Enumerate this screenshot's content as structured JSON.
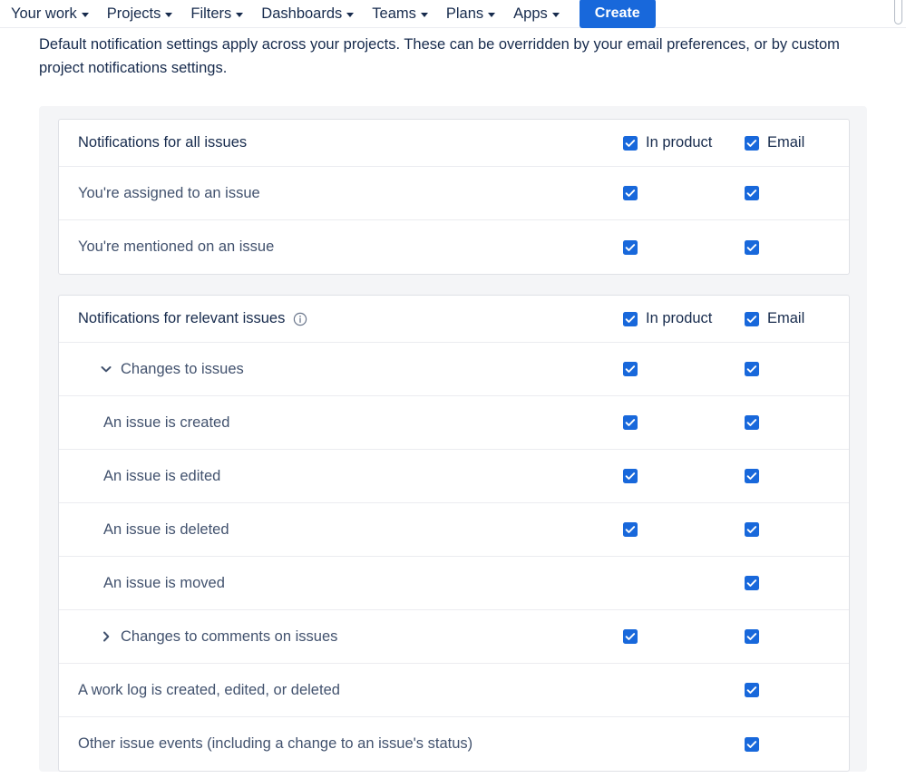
{
  "nav": {
    "items": [
      {
        "label": "Your work",
        "has_caret": true
      },
      {
        "label": "Projects",
        "has_caret": true
      },
      {
        "label": "Filters",
        "has_caret": true
      },
      {
        "label": "Dashboards",
        "has_caret": true
      },
      {
        "label": "Teams",
        "has_caret": true
      },
      {
        "label": "Plans",
        "has_caret": true
      },
      {
        "label": "Apps",
        "has_caret": true
      }
    ],
    "create_label": "Create"
  },
  "description": "Default notification settings apply across your projects. These can be overridden by your email preferences, or by custom project notifications settings.",
  "columns": {
    "in_product": "In product",
    "email": "Email"
  },
  "colors": {
    "accent": "#1868DB",
    "shell_bg": "#F4F5F7",
    "card_border": "#DFE1E6",
    "text": "#172B4D",
    "label": "#42526E"
  },
  "cards": [
    {
      "title": "Notifications for all issues",
      "has_info_icon": false,
      "rows": [
        {
          "label": "You're assigned to an issue",
          "indent": 0,
          "chevron": null,
          "in_product": true,
          "email": true
        },
        {
          "label": "You're mentioned on an issue",
          "indent": 0,
          "chevron": null,
          "in_product": true,
          "email": true
        }
      ]
    },
    {
      "title": "Notifications for relevant issues",
      "has_info_icon": true,
      "rows": [
        {
          "label": "Changes to issues",
          "indent": 1,
          "chevron": "chevron-down",
          "in_product": true,
          "email": true
        },
        {
          "label": "An issue is created",
          "indent": 2,
          "chevron": null,
          "in_product": true,
          "email": true
        },
        {
          "label": "An issue is edited",
          "indent": 2,
          "chevron": null,
          "in_product": true,
          "email": true
        },
        {
          "label": "An issue is deleted",
          "indent": 2,
          "chevron": null,
          "in_product": true,
          "email": true
        },
        {
          "label": "An issue is moved",
          "indent": 2,
          "chevron": null,
          "in_product": false,
          "email": true
        },
        {
          "label": "Changes to comments on issues",
          "indent": 1,
          "chevron": "chevron-right",
          "in_product": true,
          "email": true
        },
        {
          "label": "A work log is created, edited, or deleted",
          "indent": 0,
          "chevron": null,
          "in_product": false,
          "email": true
        },
        {
          "label": "Other issue events (including a change to an issue's status)",
          "indent": 0,
          "chevron": null,
          "in_product": false,
          "email": true
        }
      ]
    }
  ]
}
